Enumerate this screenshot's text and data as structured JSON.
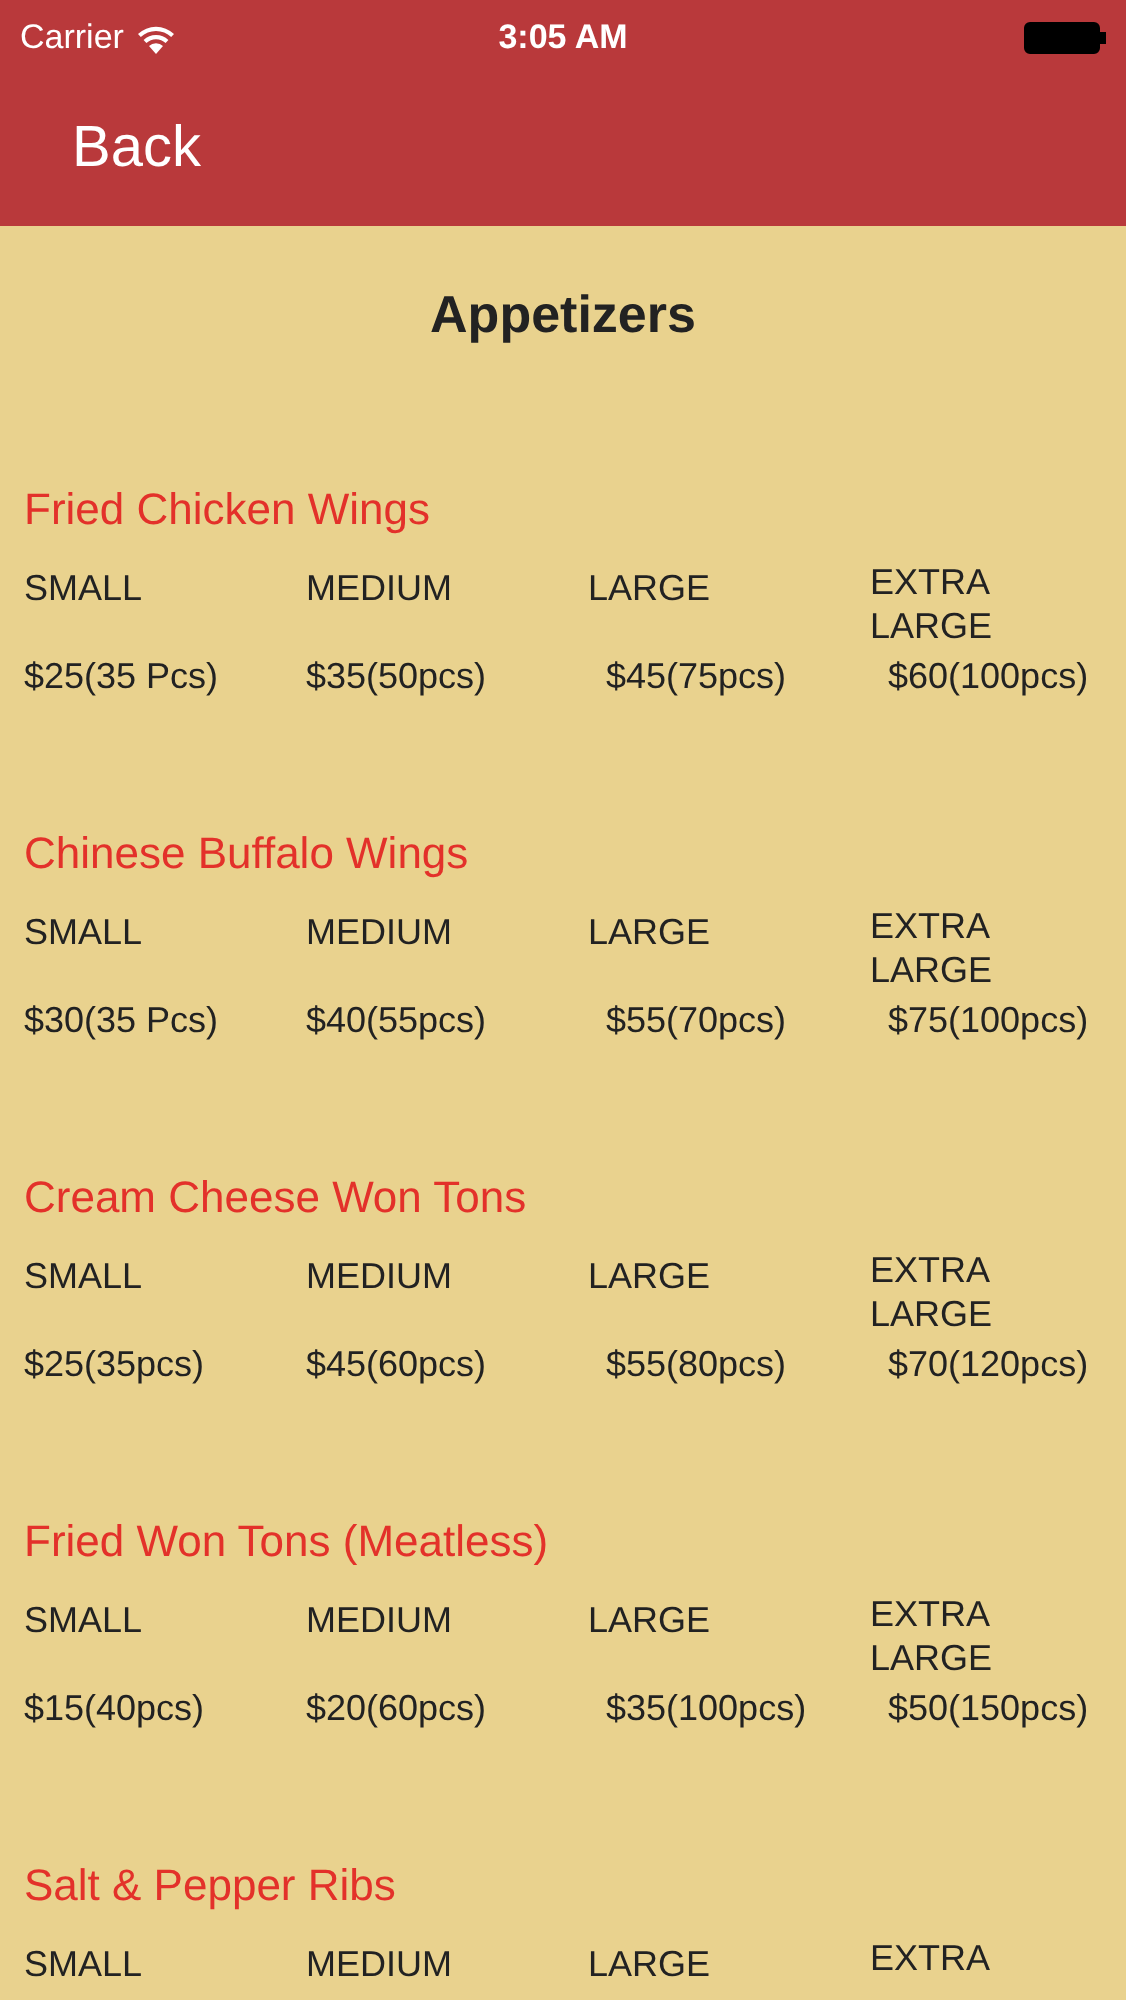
{
  "status_bar": {
    "carrier": "Carrier",
    "time": "3:05 AM"
  },
  "nav_bar": {
    "back": "Back"
  },
  "title": "Appetizers",
  "items": [
    {
      "name": "Fried Chicken Wings",
      "sizes": [
        "SMALL",
        "MEDIUM",
        "LARGE",
        "EXTRA LARGE"
      ],
      "prices": [
        "$25(35 Pcs)",
        "$35(50pcs)",
        "$45(75pcs)",
        "$60(100pcs)"
      ]
    },
    {
      "name": "Chinese Buffalo Wings",
      "sizes": [
        "SMALL",
        "MEDIUM",
        "LARGE",
        "EXTRA LARGE"
      ],
      "prices": [
        "$30(35 Pcs)",
        "$40(55pcs)",
        "$55(70pcs)",
        "$75(100pcs)"
      ]
    },
    {
      "name": "Cream Cheese Won Tons",
      "sizes": [
        "SMALL",
        "MEDIUM",
        "LARGE",
        "EXTRA LARGE"
      ],
      "prices": [
        "$25(35pcs)",
        "$45(60pcs)",
        "$55(80pcs)",
        "$70(120pcs)"
      ]
    },
    {
      "name": "Fried Won Tons (Meatless)",
      "sizes": [
        "SMALL",
        "MEDIUM",
        "LARGE",
        "EXTRA LARGE"
      ],
      "prices": [
        "$15(40pcs)",
        "$20(60pcs)",
        "$35(100pcs)",
        "$50(150pcs)"
      ]
    },
    {
      "name": "Salt & Pepper Ribs",
      "sizes": [
        "SMALL",
        "MEDIUM",
        "LARGE",
        "EXTRA"
      ]
    }
  ]
}
